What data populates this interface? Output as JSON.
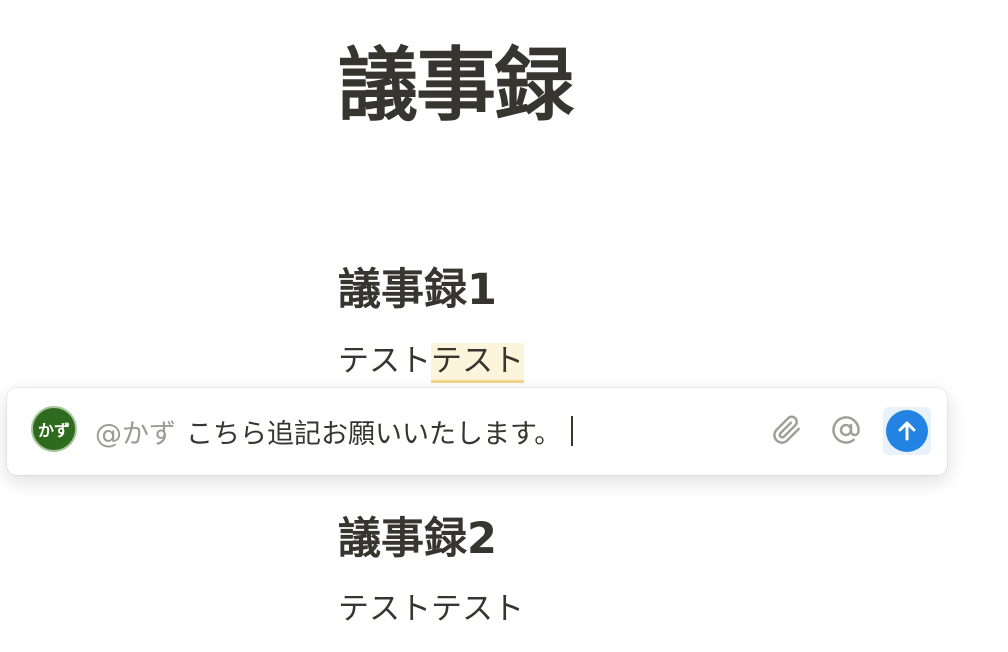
{
  "page": {
    "title": "議事録"
  },
  "sections": [
    {
      "heading": "議事録1",
      "text_plain": "テスト",
      "text_highlight": "テスト"
    },
    {
      "heading": "議事録2",
      "text": "テストテスト"
    }
  ],
  "comment": {
    "avatar_label": "かず",
    "mention": "@かず",
    "text": "こちら追記お願いいたします。",
    "icons": [
      "paperclip-icon",
      "at-icon",
      "send-arrow-icon"
    ],
    "colors": {
      "avatar_bg": "#2f6b1e",
      "send_bg": "#2383e2",
      "highlight_bg": "#fdf4dc",
      "highlight_underline": "#f3d68b"
    }
  }
}
